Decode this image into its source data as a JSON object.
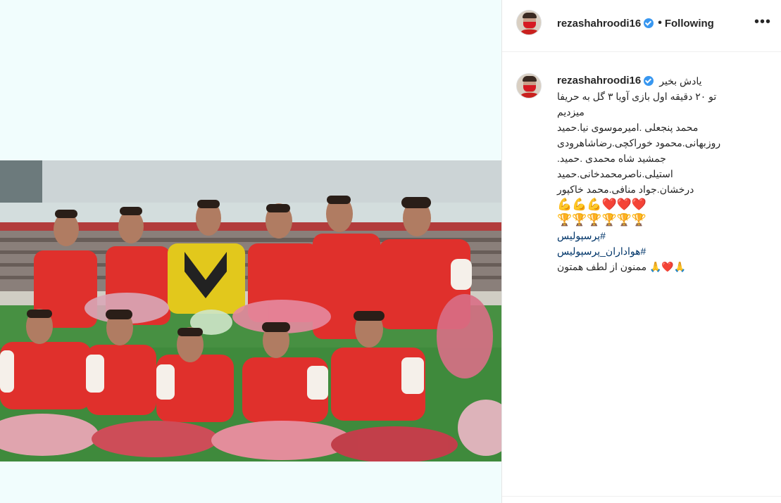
{
  "post": {
    "username": "rezashahroodi16",
    "follow_status": "Following",
    "dot": "•",
    "more": "•••"
  },
  "caption": {
    "username": "rezashahroodi16",
    "lines": [
      "یادش بخیر",
      "تو ۲۰ دقیقه اول بازی آویا ۳ گل به حریفا",
      "میزدیم",
      "محمد پنجعلی .امیرموسوی نیا.حمید",
      "روزبهانی.محمود خوراکچی.رضاشاهرودی",
      "جمشید شاه محمدی .حمید.",
      "استیلی.ناصرمحمدخانی.حمید",
      "درخشان.جواد منافی.محمد خاکپور"
    ],
    "emoji_hearts": "💪💪💪❤️❤️❤️",
    "emoji_trophies": "🏆🏆🏆🏆🏆🏆",
    "hashtags": [
      "#پرسپولیس",
      "#هواداران_پرسپولیس"
    ],
    "closing": "🙏❤️🙏 ممنون از لطف همتون"
  },
  "colors": {
    "jersey_red": "#e0302c",
    "pitch_green": "#3f8a3c",
    "hashtag": "#003569",
    "verified": "#3897f0"
  }
}
